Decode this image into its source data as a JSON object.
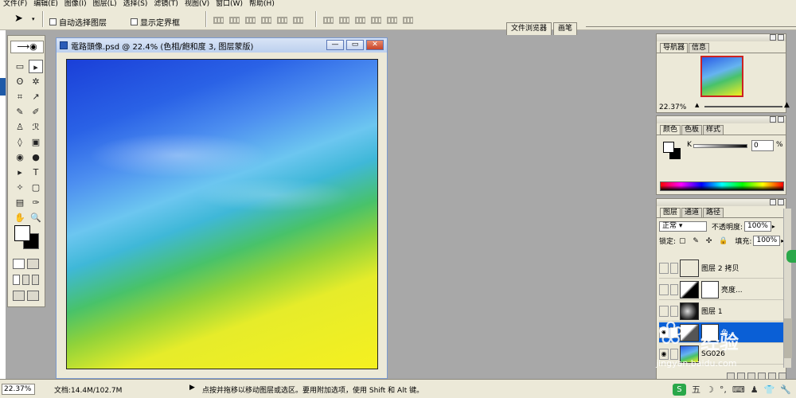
{
  "menu": [
    "文件(F)",
    "编辑(E)",
    "图像(I)",
    "图层(L)",
    "选择(S)",
    "滤镜(T)",
    "视图(V)",
    "窗口(W)",
    "帮助(H)"
  ],
  "options": {
    "auto_select_layer": "自动选择图层",
    "show_bounding_box": "显示定界框",
    "palette_well_tabs": [
      "文件浏览器",
      "画笔"
    ]
  },
  "toolbox": {
    "tools": [
      "▭",
      "▸",
      "ʘ",
      "✲",
      "⌗",
      "↗",
      "✎",
      "✐",
      "♙",
      "ℛ",
      "◊",
      "▣",
      "◉",
      "●",
      "▸",
      "T",
      "✧",
      "▢",
      "▤",
      "✑",
      "✋",
      "🔍"
    ],
    "active_index": 1
  },
  "document": {
    "title": "電路頭像.psd @ 22.4% (色相/飽和度 3, 图层蒙版)",
    "buttons": [
      "—",
      "▭",
      "✕"
    ]
  },
  "navigator": {
    "tabs": [
      "导航器",
      "信息"
    ],
    "zoom": "22.37%"
  },
  "color_panel": {
    "tabs": [
      "颜色",
      "色板",
      "样式"
    ],
    "channel_label": "K",
    "value": "0",
    "unit": "%"
  },
  "layers_panel": {
    "tabs": [
      "图层",
      "通道",
      "路径"
    ],
    "blend_mode": "正常",
    "opacity_label": "不透明度:",
    "opacity": "100%",
    "lock_label": "锁定:",
    "fill_label": "填充:",
    "fill": "100%",
    "layers": [
      {
        "name": "图层 2 拷贝",
        "selected": false
      },
      {
        "name": "亮度...",
        "selected": false
      },
      {
        "name": "图层 1",
        "selected": false
      },
      {
        "name": "色...",
        "selected": true
      },
      {
        "name": "SG026",
        "selected": false
      }
    ]
  },
  "status": {
    "zoom": "22.37%",
    "doc_size": "文档:14.4M/102.7M",
    "hint": "点按并拖移以移动图层或选区。要用附加选项，使用 Shift 和 Alt 键。"
  },
  "tray": {
    "ime_label": "S",
    "ime_mode": "五"
  },
  "watermark": {
    "brand": "经验",
    "url": "jingyan.baidu.com"
  }
}
